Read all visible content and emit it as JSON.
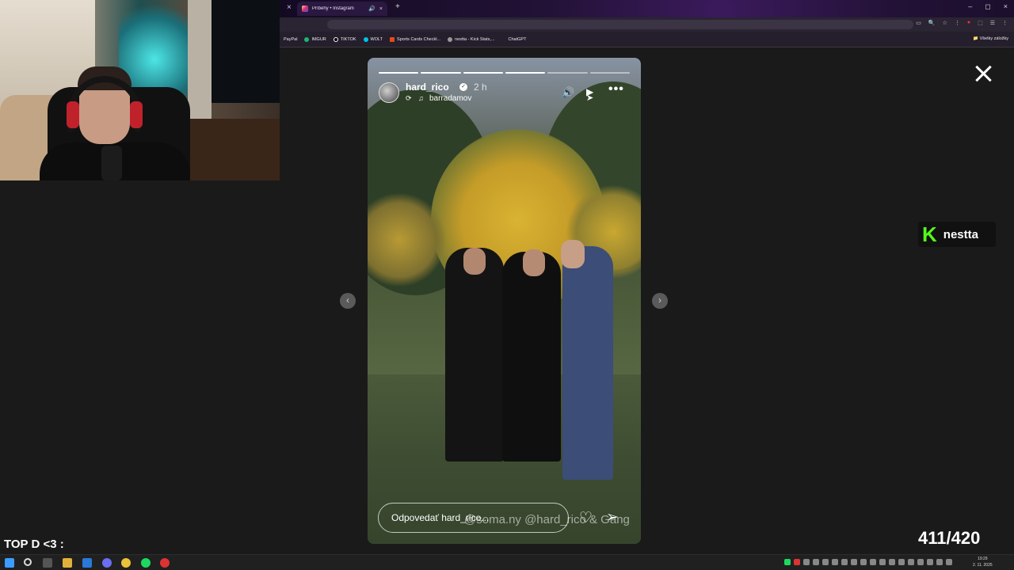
{
  "browser": {
    "tab_title": "Príbehy • Instagram",
    "tab_audio_icon": "speaker-icon",
    "tab_close": "×",
    "new_tab": "+",
    "window_controls": [
      "–",
      "◻",
      "×"
    ],
    "toolbar_icons": [
      "▭",
      "🔍",
      "☆",
      "⋮",
      "●",
      "⬚",
      "☰",
      "⋮"
    ]
  },
  "bookmarks": [
    {
      "label": "PayPal",
      "color": "#1e3a8a"
    },
    {
      "label": "IMGUR",
      "color": "#1bb76e"
    },
    {
      "label": "TIKTOK",
      "color": "#000000"
    },
    {
      "label": "WOLT",
      "color": "#00c2e8"
    },
    {
      "label": "Sports Cards Checkl...",
      "color": "#e34b1b"
    },
    {
      "label": "nestta - Kick Stats,...",
      "color": "#999999"
    },
    {
      "label": "ChatGPT",
      "color": "#10a37f"
    }
  ],
  "bookmarks_all": "Všetky záložky",
  "story": {
    "username": "hard_rico",
    "time_ago": "2 h",
    "repost_user": "barradamov",
    "progress_total": 6,
    "progress_done": 4,
    "reply_placeholder": "Odpovedať hard_rico...",
    "overlay_tag": "@soma.ny @hard_rico & Gang"
  },
  "icons": {
    "close": "close-icon",
    "volume": "volume-icon",
    "play": "play-icon",
    "more": "more-icon",
    "like": "heart-icon",
    "share": "send-icon",
    "prev": "chevron-left-icon",
    "next": "chevron-right-icon"
  },
  "overlay": {
    "kick_logo": "K",
    "kick_name": "nestta",
    "top_text": "TOP D <3 :",
    "counter": "411/420"
  },
  "taskbar": {
    "time": "19:29",
    "date": "2. 11. 2025"
  },
  "colors": {
    "kick_green": "#53fc18",
    "instagram_gradient": "#d62976"
  }
}
